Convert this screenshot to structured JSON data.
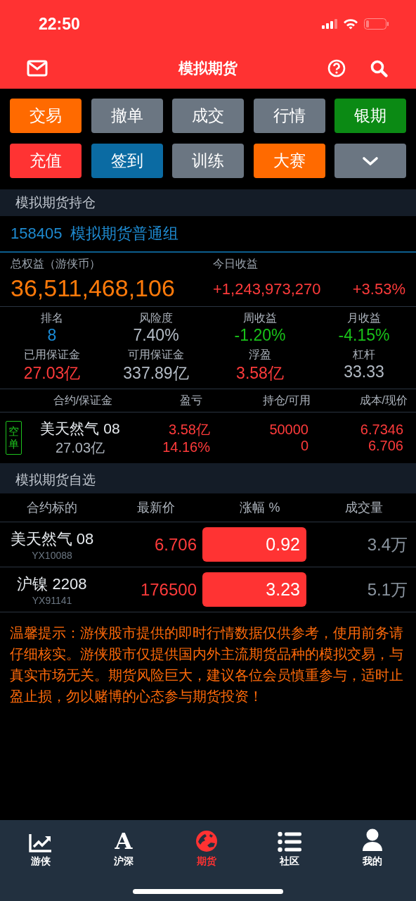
{
  "status_bar": {
    "time": "22:50"
  },
  "nav": {
    "title": "模拟期货"
  },
  "actions": [
    {
      "label": "交易",
      "color": "#ff6a00"
    },
    {
      "label": "撤单",
      "color": "#6b7682"
    },
    {
      "label": "成交",
      "color": "#6b7682"
    },
    {
      "label": "行情",
      "color": "#6b7682"
    },
    {
      "label": "银期",
      "color": "#0b8a14"
    },
    {
      "label": "充值",
      "color": "#ff3333"
    },
    {
      "label": "签到",
      "color": "#0b6ba3"
    },
    {
      "label": "训练",
      "color": "#6b7682"
    },
    {
      "label": "大赛",
      "color": "#ff6a00"
    },
    {
      "kind": "more",
      "color": "#6b7682"
    }
  ],
  "holdings": {
    "title": "模拟期货持仓",
    "account": {
      "id": "158405",
      "group": "模拟期货普通组"
    },
    "equity": {
      "label": "总权益（游侠币）",
      "value": "36,511,468,106"
    },
    "today": {
      "label": "今日收益",
      "value": "+1,243,973,270",
      "percent": "+3.53%"
    },
    "stats": [
      {
        "label": "排名",
        "value": "8",
        "color": "#1a8cd8"
      },
      {
        "label": "风险度",
        "value": "7.40%",
        "color": "#b4bcc6"
      },
      {
        "label": "周收益",
        "value": "-1.20%",
        "color": "#19c219"
      },
      {
        "label": "月收益",
        "value": "-4.15%",
        "color": "#19c219"
      },
      {
        "label": "已用保证金",
        "value": "27.03亿",
        "color": "#ff3b3b"
      },
      {
        "label": "可用保证金",
        "value": "337.89亿",
        "color": "#b4bcc6"
      },
      {
        "label": "浮盈",
        "value": "3.58亿",
        "color": "#ff3b3b"
      },
      {
        "label": "杠杆",
        "value": "33.33",
        "color": "#b4bcc6"
      }
    ],
    "columns": [
      "合约/保证金",
      "盈亏",
      "持仓/可用",
      "成本/现价"
    ],
    "positions": [
      {
        "side": "空单",
        "name": "美天然气 08",
        "margin": "27.03亿",
        "pnl": "3.58亿",
        "pnl_pct": "14.16%",
        "holding": "50000",
        "available": "0",
        "cost": "6.7346",
        "price": "6.706"
      }
    ]
  },
  "watchlist": {
    "title": "模拟期货自选",
    "columns": [
      "合约标的",
      "最新价",
      "涨幅 %",
      "成交量"
    ],
    "rows": [
      {
        "name": "美天然气 08",
        "code": "YX10088",
        "price": "6.706",
        "change": "0.92",
        "volume": "3.4万"
      },
      {
        "name": "沪镍 2208",
        "code": "YX91141",
        "price": "176500",
        "change": "3.23",
        "volume": "5.1万"
      }
    ]
  },
  "notice": "温馨提示：游侠股市提供的即时行情数据仅供参考，使用前务请仔细核实。游侠股市仅提供国内外主流期货品种的模拟交易，与真实市场无关。期货风险巨大，建议各位会员慎重参与，适时止盈止损，勿以赌博的心态参与期货投资！",
  "tab_bar": [
    {
      "label": "游侠",
      "kind": "chart",
      "selected": false
    },
    {
      "label": "沪深",
      "kind": "letter",
      "glyph": "A",
      "selected": false
    },
    {
      "label": "期货",
      "kind": "globe",
      "selected": true
    },
    {
      "label": "社区",
      "kind": "list",
      "selected": false
    },
    {
      "label": "我的",
      "kind": "person",
      "selected": false
    }
  ]
}
